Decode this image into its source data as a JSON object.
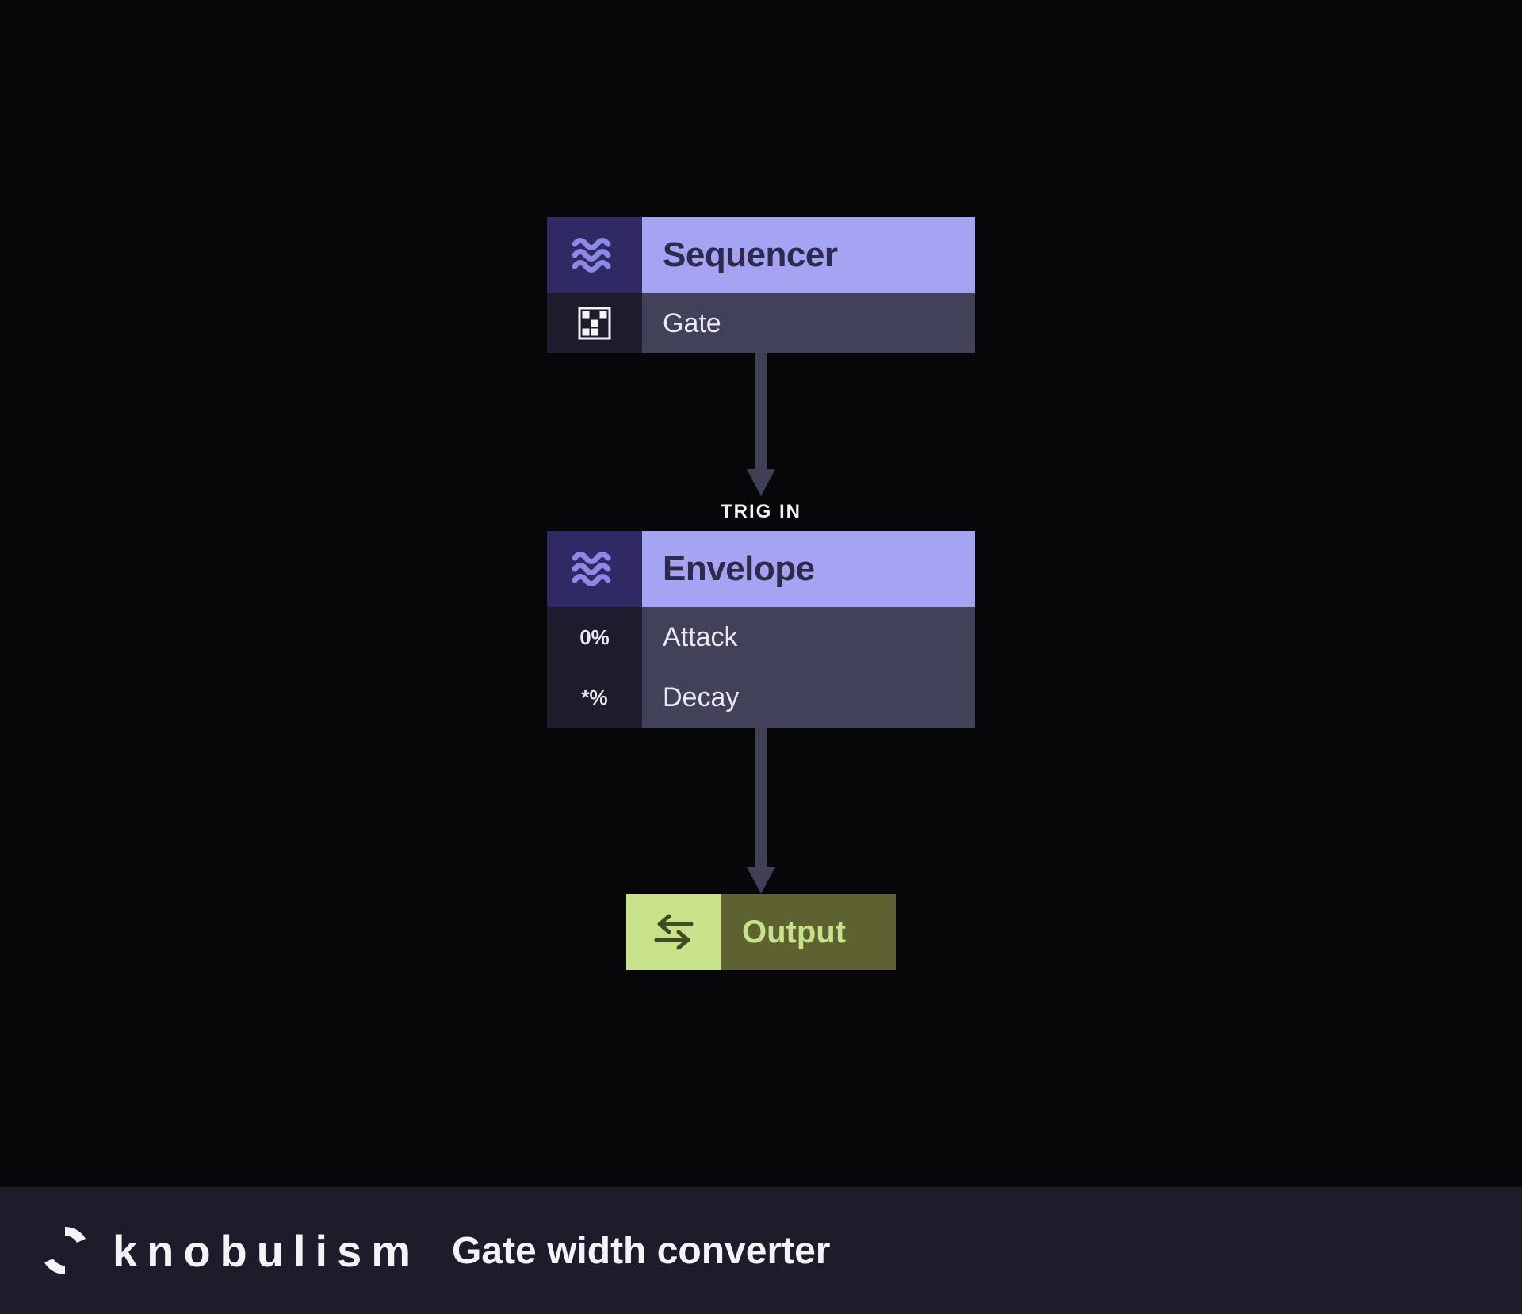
{
  "footer": {
    "brand": "knobulism",
    "title": "Gate width converter"
  },
  "arrows": {
    "trig_label": "TRIG IN"
  },
  "modules": {
    "sequencer": {
      "title": "Sequencer",
      "rows": [
        {
          "left_value": "",
          "right_label": "Gate",
          "left_icon": "pattern-icon"
        }
      ]
    },
    "envelope": {
      "title": "Envelope",
      "rows": [
        {
          "left_value": "0%",
          "right_label": "Attack"
        },
        {
          "left_value": "*%",
          "right_label": "Decay"
        }
      ]
    },
    "output": {
      "title": "Output"
    }
  }
}
